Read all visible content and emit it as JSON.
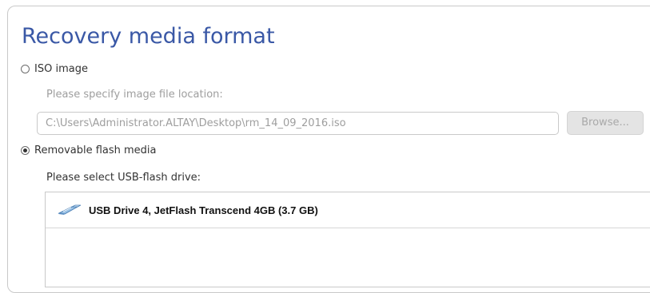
{
  "title": "Recovery media format",
  "iso_option": {
    "label": "ISO image",
    "selected": false,
    "location_label": "Please specify image file location:",
    "path_value": "C:\\Users\\Administrator.ALTAY\\Desktop\\rm_14_09_2016.iso",
    "browse_label": "Browse..."
  },
  "flash_option": {
    "label": "Removable flash media",
    "selected": true,
    "select_label": "Please select USB-flash drive:",
    "drives": [
      {
        "label": "USB Drive 4, JetFlash Transcend 4GB (3.7 GB)",
        "icon": "usb-drive-icon"
      }
    ]
  },
  "colors": {
    "title": "#3a58a6",
    "disabled_text": "#9e9e9e",
    "border": "#c9c9c9"
  }
}
